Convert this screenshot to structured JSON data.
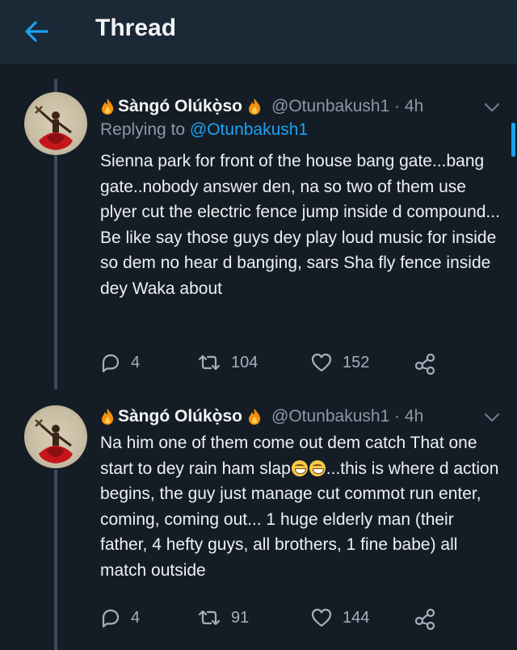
{
  "header": {
    "title": "Thread"
  },
  "tweets": [
    {
      "display_name": "Sàngó Olúkọ̀so",
      "handle_time": "@Otunbakush1 · 4h",
      "replying_prefix": "Replying to",
      "replying_handle": "@Otunbakush1",
      "text": "Sienna park for front of the house bang gate...bang gate..nobody answer den, na so two of them use plyer cut the electric fence jump inside d compound... Be like say those guys dey play loud music for inside so dem no hear d banging, sars Sha fly fence inside dey Waka about",
      "replies": "4",
      "retweets": "104",
      "likes": "152"
    },
    {
      "display_name": "Sàngó Olúkọ̀so",
      "handle_time": "@Otunbakush1 · 4h",
      "text_before_emoji": "Na him one of them come out dem catch That one start to dey rain ham slap",
      "emoji": "grinning-squinting-face-emoji",
      "text_after_emoji": "...this is where d action begins, the guy just manage cut commot run enter, coming, coming out... 1 huge elderly man (their father, 4 hefty guys, all brothers, 1 fine babe) all match outside",
      "replies": "4",
      "retweets": "91",
      "likes": "144"
    }
  ],
  "colors": {
    "background": "#141d26",
    "header": "#1b2836",
    "accent": "#1da1f2",
    "muted": "#8b98a5"
  }
}
